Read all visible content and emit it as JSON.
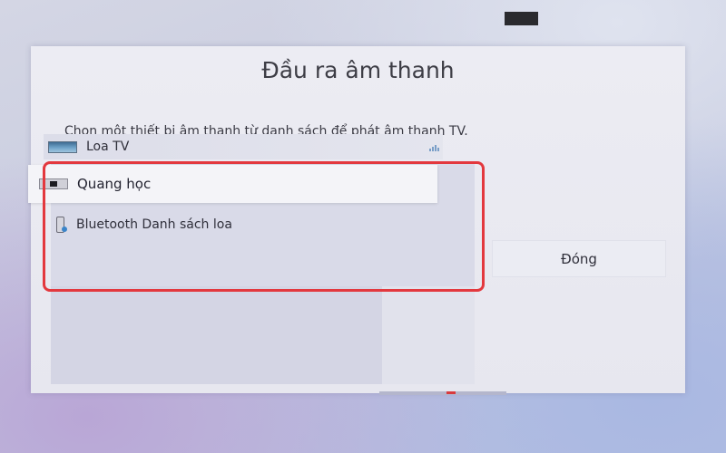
{
  "dialog": {
    "title": "Đầu ra âm thanh",
    "description": "Chọn một thiết bị âm thanh từ danh sách để phát âm thanh TV."
  },
  "devices": [
    {
      "label": "Loa TV",
      "icon": "tv-speaker-icon",
      "signal_icon": "signal-bars-icon",
      "selected": false
    },
    {
      "label": "Quang học",
      "icon": "optical-port-icon",
      "selected": true
    },
    {
      "label": "Bluetooth Danh sách loa",
      "icon": "bluetooth-speaker-icon",
      "selected": false
    }
  ],
  "buttons": {
    "close_label": "Đóng"
  },
  "colors": {
    "highlight": "#e3383e",
    "dialog_bg": "#e9e9f1",
    "focused_item_bg": "#f4f4f8"
  }
}
